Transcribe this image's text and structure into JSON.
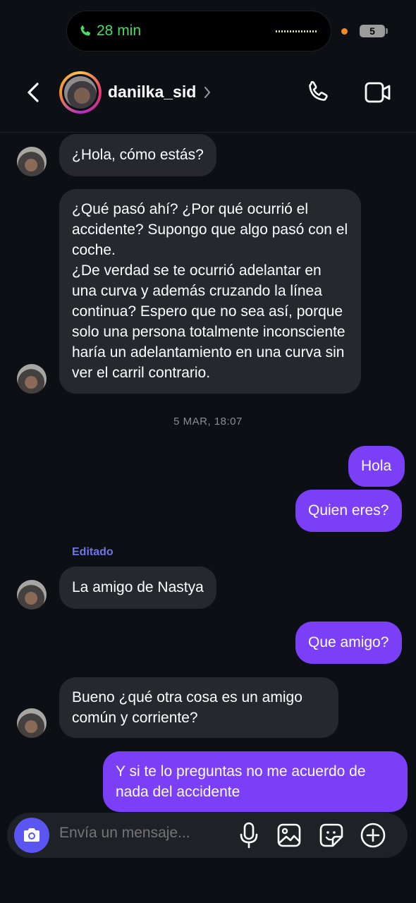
{
  "status": {
    "call_time": "28 min",
    "battery": "5"
  },
  "header": {
    "username": "danilka_sid"
  },
  "messages": {
    "m1": "¿Hola, cómo estás?",
    "m2a": "¿Qué pasó ahí? ¿Por qué ocurrió el accidente? Supongo que algo pasó con el coche.",
    "m2b": "¿De verdad se te ocurrió adelantar en una curva y además cruzando la línea continua? Espero que no sea así, porque solo una persona totalmente inconsciente haría un adelantamiento en una curva sin ver el carril contrario.",
    "timestamp": "5 MAR, 18:07",
    "m3": "Hola",
    "m4": "Quien eres?",
    "edited": "Editado",
    "m5": "La amigo de Nastya",
    "m6": "Que amigo?",
    "m7": "Bueno ¿qué otra cosa es un amigo común y corriente?",
    "m8": "Y si te lo preguntas no me acuerdo de nada del accidente"
  },
  "composer": {
    "placeholder": "Envía un mensaje..."
  },
  "colors": {
    "outgoing_bubble": "#7a3ff6",
    "incoming_bubble": "#26282e",
    "call_green": "#45dd63",
    "accent_blue": "#5b56f2"
  },
  "icons": [
    "phone-icon",
    "back-chevron-icon",
    "chevron-right-icon",
    "phone-call-icon",
    "video-call-icon",
    "camera-icon",
    "microphone-icon",
    "gallery-icon",
    "sticker-icon",
    "plus-circle-icon"
  ]
}
